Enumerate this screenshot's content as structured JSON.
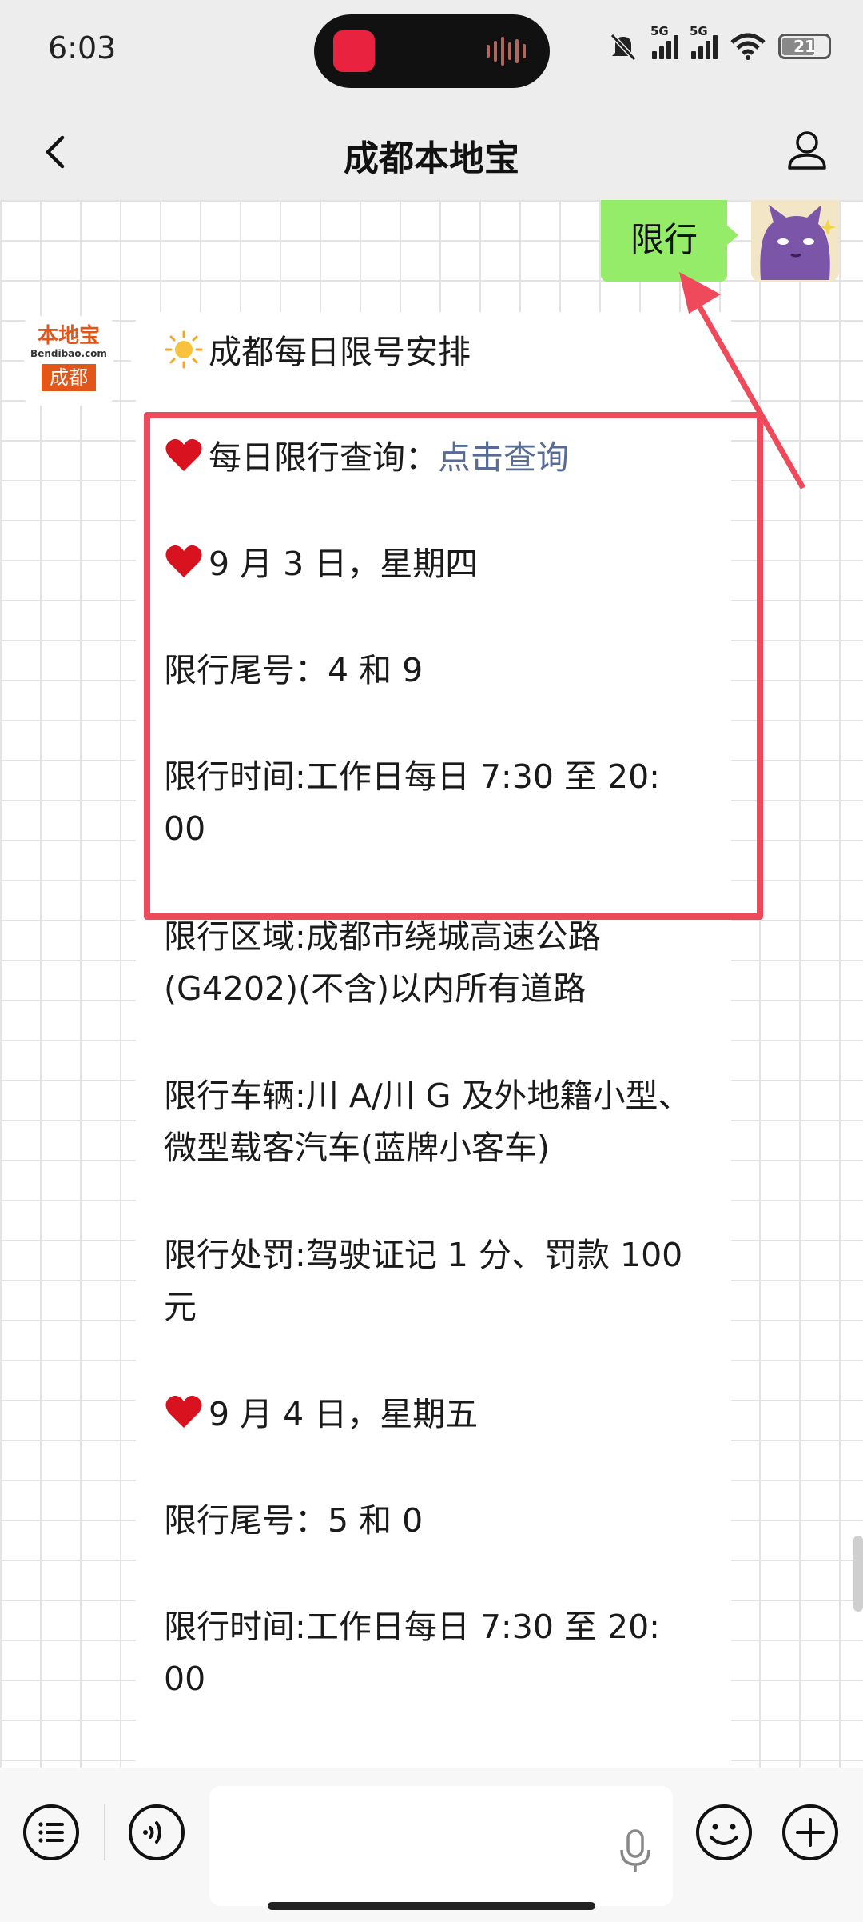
{
  "status_bar": {
    "time": "6:03",
    "signal_1": "5G",
    "signal_2": "5G",
    "battery": "21"
  },
  "header": {
    "title": "成都本地宝",
    "back_icon": "chevron-left-icon",
    "profile_icon": "person-icon"
  },
  "chat": {
    "my_message": "限行",
    "bot_avatar": {
      "brand": "本地宝",
      "url": "Bendibao.com",
      "city": "成都"
    },
    "bot_message": {
      "heading": "成都每日限号安排",
      "query_prefix": "每日限行查询：",
      "query_link": "点击查询",
      "day1_date": "9 月 3 日，星期四",
      "day1_tail": "限行尾号：4 和 9",
      "day1_time_a": "限行时间:工作日每日 7:30 至 20:",
      "day1_time_b": "00",
      "area_a": "限行区域:成都市绕城高速公路",
      "area_b": "(G4202)(不含)以内所有道路",
      "vehicle_a": "限行车辆:川 A/川 G 及外地籍小型、",
      "vehicle_b": "微型载客汽车(蓝牌小客车)",
      "penalty_a": "限行处罚:驾驶证记 1 分、罚款 100",
      "penalty_b": "元",
      "day2_date": "9 月 4 日，星期五",
      "day2_tail": "限行尾号：5 和 0",
      "day2_time_a": "限行时间:工作日每日 7:30 至 20:",
      "day2_time_b": "00"
    }
  },
  "toolbar": {
    "menu_icon": "list-menu-icon",
    "voice_icon": "voice-mode-icon",
    "mic_icon": "microphone-icon",
    "emoji_icon": "emoji-icon",
    "add_icon": "plus-icon"
  },
  "colors": {
    "bubble_green": "#95ec69",
    "link_blue": "#576b95",
    "annotation_red": "#ef4a5c"
  }
}
